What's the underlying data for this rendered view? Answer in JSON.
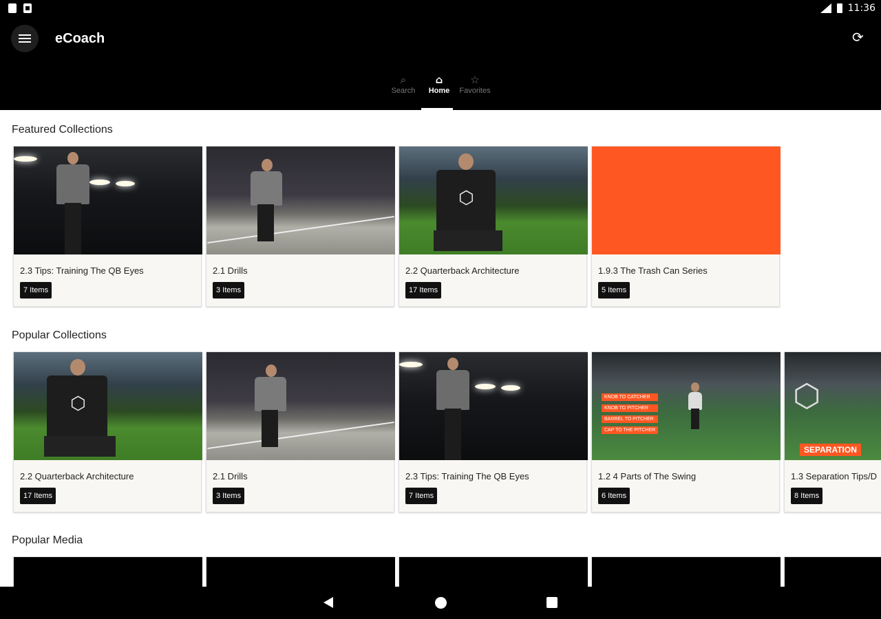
{
  "status_bar": {
    "time": "11:36"
  },
  "app": {
    "title": "eCoach"
  },
  "tabs": [
    {
      "label": "Search",
      "icon": "search-icon",
      "active": false
    },
    {
      "label": "Home",
      "icon": "home-icon",
      "active": true
    },
    {
      "label": "Favorites",
      "icon": "star-icon",
      "active": false
    }
  ],
  "featured": {
    "title": "Featured Collections",
    "cards": [
      {
        "title": "2.3 Tips: Training The QB Eyes",
        "badge": "7 Items"
      },
      {
        "title": "2.1 Drills",
        "badge": "3 Items"
      },
      {
        "title": "2.2 Quarterback Architecture",
        "badge": "17 Items"
      },
      {
        "title": "1.9.3 The Trash Can Series",
        "badge": "5 Items"
      }
    ]
  },
  "popular": {
    "title": "Popular Collections",
    "cards": [
      {
        "title": "2.2 Quarterback Architecture",
        "badge": "17 Items"
      },
      {
        "title": "2.1 Drills",
        "badge": "3 Items"
      },
      {
        "title": "2.3 Tips: Training The QB Eyes",
        "badge": "7 Items"
      },
      {
        "title": "1.2 4 Parts of The Swing",
        "badge": "6 Items",
        "overlay": [
          "KNOB TO CATCHER",
          "KNOB TO PITCHER",
          "BARREL TO PITCHER",
          "CAP TO THE PITCHER"
        ]
      },
      {
        "title": "1.3 Separation Tips/D",
        "badge": "8 Items",
        "tag": "SEPARATION"
      }
    ]
  },
  "media": {
    "title": "Popular Media"
  },
  "colors": {
    "accent": "#ff5722",
    "bar": "#000000",
    "card_bg": "#f8f7f3"
  }
}
